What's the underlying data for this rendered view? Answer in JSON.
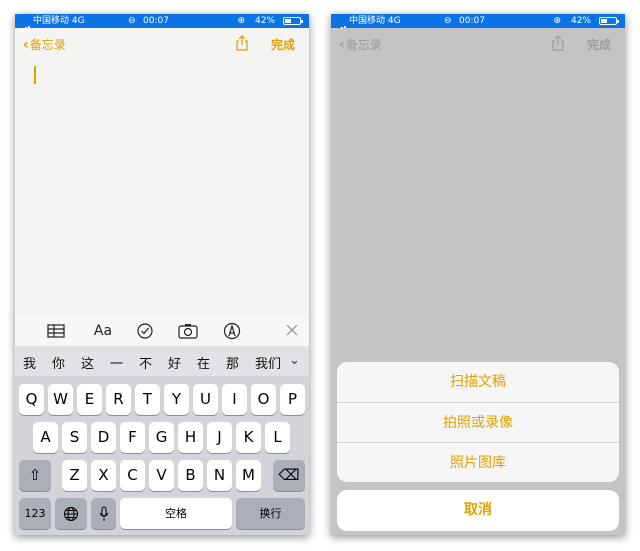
{
  "colors": {
    "accent": "#e2a100",
    "statusbar": "#0a73e6",
    "dim": "#c4c4c4"
  },
  "status": {
    "carrier": "中国移动 4G",
    "time": "00:07",
    "battery": "42%"
  },
  "nav": {
    "back_label": "备忘录",
    "done_label": "完成",
    "share_icon": "share-icon"
  },
  "toolbar": {
    "format_label": "Aa",
    "icons": [
      "table-icon",
      "format-icon",
      "checklist-icon",
      "camera-icon",
      "markup-icon",
      "close-icon"
    ]
  },
  "candidates": [
    "我",
    "你",
    "这",
    "一",
    "不",
    "好",
    "在",
    "那",
    "我们"
  ],
  "keyboard": {
    "row1": [
      "Q",
      "W",
      "E",
      "R",
      "T",
      "Y",
      "U",
      "I",
      "O",
      "P"
    ],
    "row2": [
      "A",
      "S",
      "D",
      "F",
      "G",
      "H",
      "J",
      "K",
      "L"
    ],
    "row3": [
      "Z",
      "X",
      "C",
      "V",
      "B",
      "N",
      "M"
    ],
    "numbers_label": "123",
    "space_label": "空格",
    "return_label": "换行"
  },
  "sheet": {
    "options": [
      "扫描文稿",
      "拍照或录像",
      "照片图库"
    ],
    "cancel_label": "取消"
  }
}
